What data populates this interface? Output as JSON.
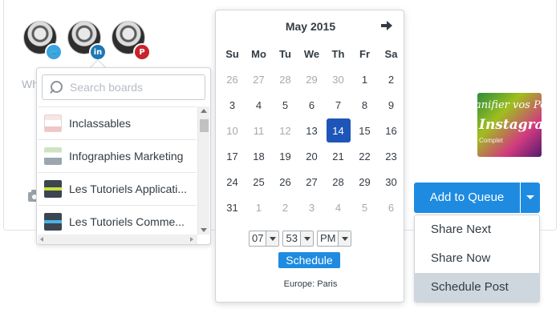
{
  "composer": {
    "placeholder_visible": "Wh",
    "accounts": [
      {
        "network": "twitter",
        "badge_glyph": "🐦"
      },
      {
        "network": "linkedin",
        "badge_glyph": "in"
      },
      {
        "network": "pinterest",
        "badge_glyph": "P"
      }
    ],
    "thumbnail_text": {
      "line1": "anifier vos Pos",
      "line2": "Instagram",
      "line3": "Complet"
    }
  },
  "boards": {
    "search_placeholder": "Search boards",
    "items": [
      {
        "label": "Inclassables"
      },
      {
        "label": "Infographies Marketing"
      },
      {
        "label": "Les Tutoriels Applicati..."
      },
      {
        "label": "Les Tutoriels Comme..."
      }
    ]
  },
  "calendar": {
    "title": "May 2015",
    "weekdays": [
      "Su",
      "Mo",
      "Tu",
      "We",
      "Th",
      "Fr",
      "Sa"
    ],
    "days": [
      [
        "26",
        "27",
        "28",
        "29",
        "30",
        "1",
        "2"
      ],
      [
        "3",
        "4",
        "5",
        "6",
        "7",
        "8",
        "9"
      ],
      [
        "10",
        "11",
        "12",
        "13",
        "14",
        "15",
        "16"
      ],
      [
        "17",
        "18",
        "19",
        "20",
        "21",
        "22",
        "23"
      ],
      [
        "24",
        "25",
        "26",
        "27",
        "28",
        "29",
        "30"
      ],
      [
        "31",
        "1",
        "2",
        "3",
        "4",
        "5",
        "6"
      ]
    ],
    "selected_day": "14",
    "time": {
      "hour": "07",
      "minute": "53",
      "ampm": "PM"
    },
    "schedule_label": "Schedule",
    "timezone": "Europe: Paris"
  },
  "queue": {
    "button_label": "Add to Queue",
    "menu": [
      "Share Next",
      "Share Now",
      "Schedule Post"
    ],
    "active_item": "Schedule Post"
  },
  "colors": {
    "accent": "#1e8be0",
    "selected_day": "#1e55b8",
    "menu_highlight": "#ced6de"
  }
}
